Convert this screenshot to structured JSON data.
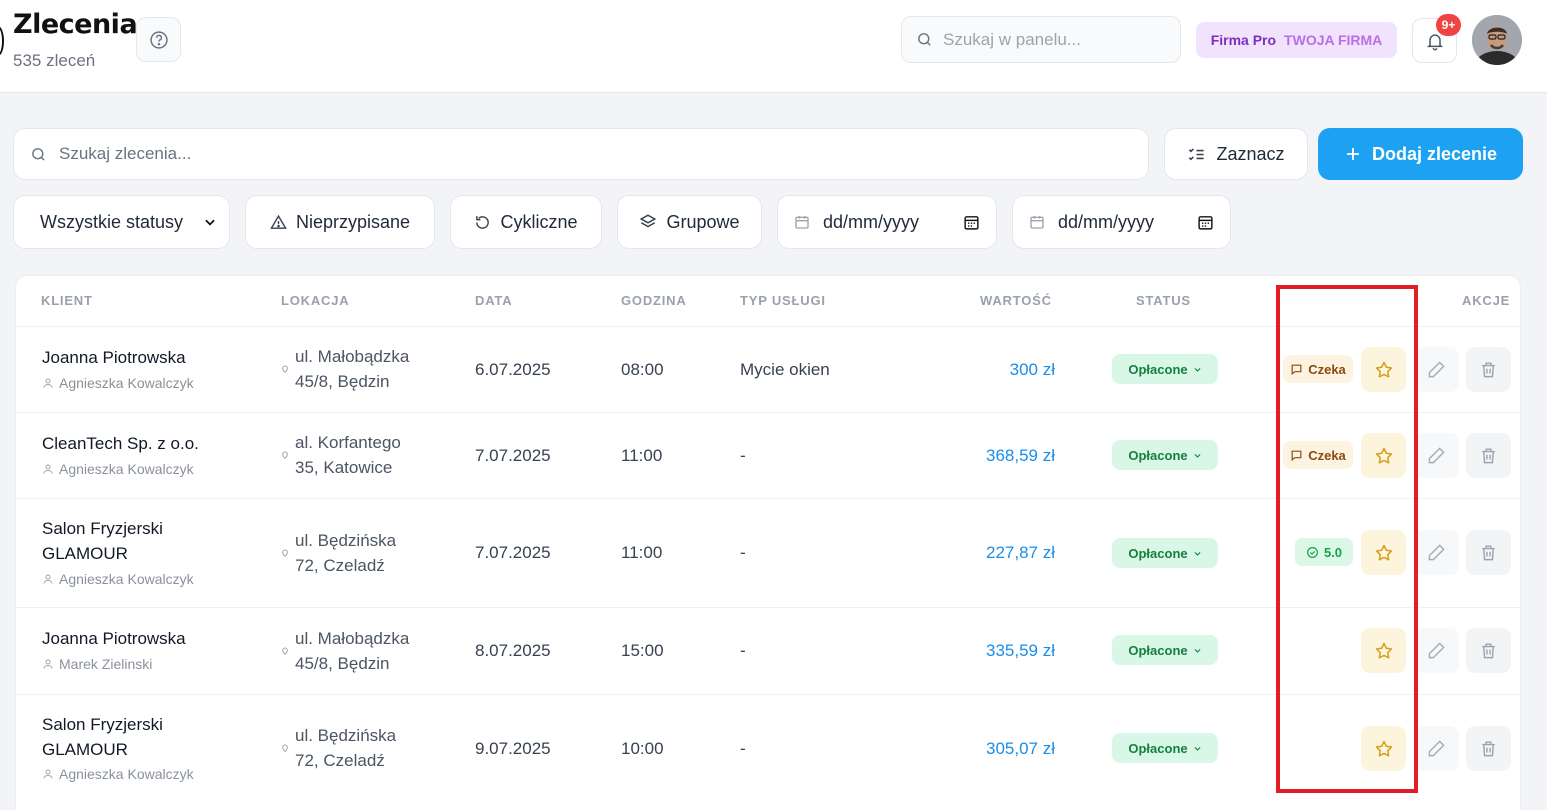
{
  "header": {
    "title": "Zlecenia",
    "subtitle": "535 zleceń",
    "search_placeholder": "Szukaj w panelu...",
    "plan": "Firma Pro",
    "company": "TWOJA FIRMA",
    "notifications_count": "9+"
  },
  "toolbar": {
    "search_placeholder": "Szukaj zlecenia...",
    "select_label": "Zaznacz",
    "add_label": "Dodaj zlecenie"
  },
  "filters": {
    "status": "Wszystkie statusy",
    "unassigned": "Nieprzypisane",
    "cyclic": "Cykliczne",
    "group": "Grupowe",
    "date_from": "dd/mm/yyyy",
    "date_to": "dd/mm/yyyy"
  },
  "table": {
    "columns": {
      "client": "KLIENT",
      "location": "LOKACJA",
      "date": "DATA",
      "time": "GODZINA",
      "service": "TYP USŁUGI",
      "value": "WARTOŚĆ",
      "status": "STATUS",
      "actions": "AKCJE"
    },
    "rows": [
      {
        "client": "Joanna Piotrowska",
        "assignee": "Agnieszka Kowalczyk",
        "location": "ul. Małobądzka 45/8, Będzin",
        "date": "6.07.2025",
        "time": "08:00",
        "service": "Mycie okien",
        "value": "300 zł",
        "status": "Opłacone",
        "note": "Czeka"
      },
      {
        "client": "CleanTech Sp. z o.o.",
        "assignee": "Agnieszka Kowalczyk",
        "location": "al. Korfantego 35, Katowice",
        "date": "7.07.2025",
        "time": "11:00",
        "service": "-",
        "value": "368,59 zł",
        "status": "Opłacone",
        "note": "Czeka"
      },
      {
        "client": "Salon Fryzjerski GLAMOUR",
        "assignee": "Agnieszka Kowalczyk",
        "location": "ul. Będzińska 72, Czeladź",
        "date": "7.07.2025",
        "time": "11:00",
        "service": "-",
        "value": "227,87 zł",
        "status": "Opłacone",
        "rating": "5.0"
      },
      {
        "client": "Joanna Piotrowska",
        "assignee": "Marek Zielinski",
        "location": "ul. Małobądzka 45/8, Będzin",
        "date": "8.07.2025",
        "time": "15:00",
        "service": "-",
        "value": "335,59 zł",
        "status": "Opłacone"
      },
      {
        "client": "Salon Fryzjerski GLAMOUR",
        "assignee": "Agnieszka Kowalczyk",
        "location": "ul. Będzińska 72, Czeladź",
        "date": "9.07.2025",
        "time": "10:00",
        "service": "-",
        "value": "305,07 zł",
        "status": "Opłacone"
      }
    ]
  },
  "colors": {
    "accent": "#1da1f2",
    "value_text": "#1a8ee8",
    "status_bg": "#d9f7e7",
    "status_text": "#15803d",
    "highlight": "#e11d26"
  },
  "icons": [
    "help-icon",
    "search-icon",
    "bell-icon",
    "checklist-icon",
    "plus-icon",
    "chevron-down-icon",
    "warning-icon",
    "refresh-icon",
    "layers-icon",
    "calendar-icon",
    "user-icon",
    "pin-icon",
    "message-icon",
    "check-circle-icon",
    "star-icon",
    "pencil-icon",
    "trash-icon"
  ]
}
